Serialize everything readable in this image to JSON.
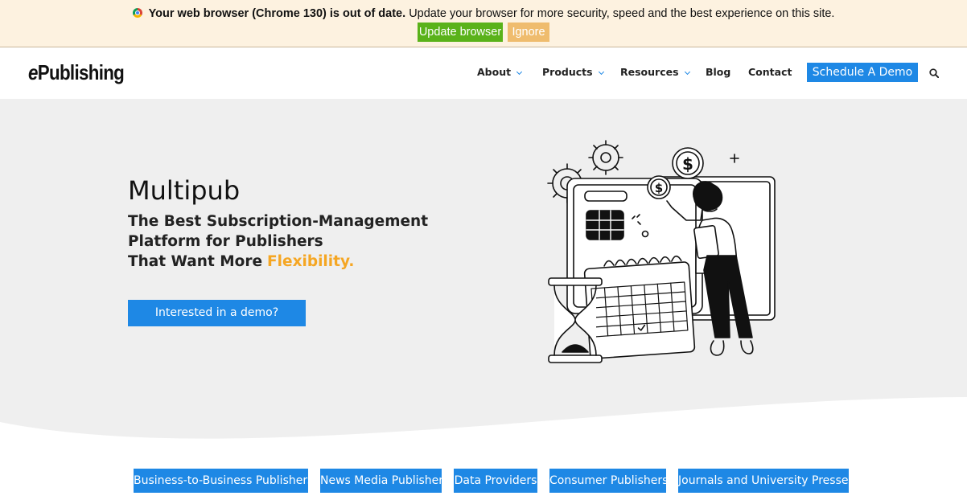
{
  "banner": {
    "bold_text": "Your web browser (Chrome 130) is out of date.",
    "text": "Update your browser for more security, speed and the best experience on this site.",
    "update_label": "Update browser",
    "ignore_label": "Ignore",
    "icon": "chrome-icon"
  },
  "header": {
    "logo_e": "e",
    "logo_rest": "Publishing",
    "nav": {
      "about": "About",
      "products": "Products",
      "resources": "Resources",
      "blog": "Blog",
      "contact": "Contact"
    },
    "demo_label": "Schedule A Demo",
    "search_icon": "search-icon"
  },
  "hero": {
    "title": "Multipub",
    "line1": "The Best Subscription-Management",
    "line2": "Platform for Publishers",
    "line3": "That Want More",
    "accent": "Flexibility.",
    "cta_label": "Interested in a demo?"
  },
  "tags": [
    "Business-to-Business Publishers",
    "News Media Publisher",
    "Data Providers",
    "Consumer Publishers",
    "Journals and University Presses"
  ],
  "colors": {
    "primary": "#1e88e5",
    "accent": "#f5a623",
    "update_green": "#5ab21a",
    "ignore_orange": "#efbc6e",
    "banner_bg": "#fdf2e0",
    "hero_bg": "#efefef"
  }
}
